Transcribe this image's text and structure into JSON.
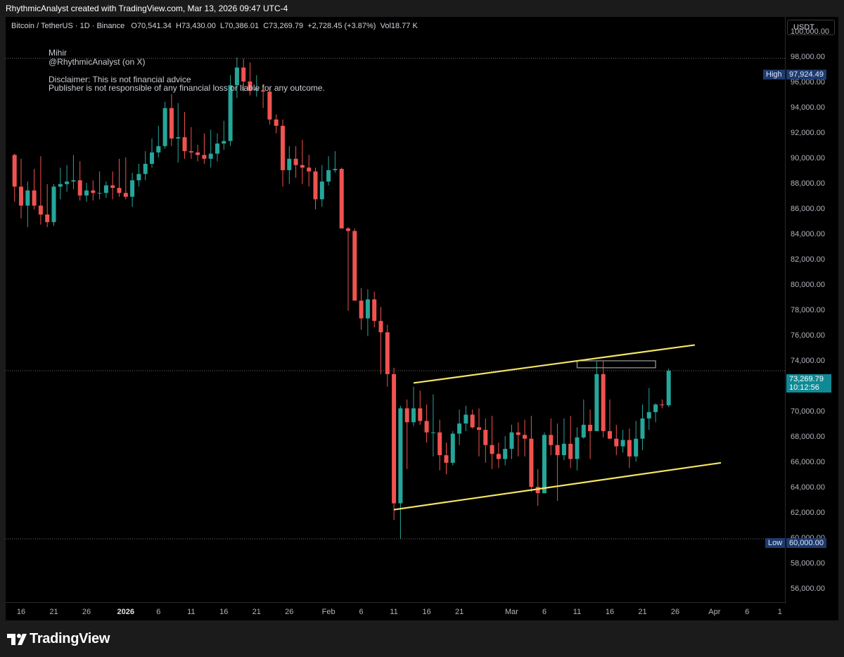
{
  "header": {
    "attribution": "RhythmicAnalyst created with TradingView.com, Mar 13, 2026 09:47 UTC-4"
  },
  "legend": {
    "symbol": "Bitcoin / TetherUS · 1D · Binance",
    "open_label": "O",
    "open": "70,541.34",
    "high_label": "H",
    "high": "73,430.00",
    "low_label": "L",
    "low": "70,386.01",
    "close_label": "C",
    "close": "73,269.79",
    "change": "+2,728.45 (+3.87%)",
    "vol_label": "Vol",
    "vol": "18.77 K"
  },
  "notes": {
    "author": "Mihir",
    "handle": "@RhythmicAnalyst (on X)",
    "disclaimer1": "Disclaimer: This is not financial advice",
    "disclaimer2": "Publisher is not responsible of any financial loss or liable for any outcome."
  },
  "currency": "USDT",
  "markers": {
    "high_label": "High",
    "high_value": "97,924.49",
    "low_label": "Low",
    "low_value": "60,000.00",
    "last_price": "73,269.79",
    "countdown": "10:12:56"
  },
  "footer": {
    "brand": "TradingView"
  },
  "colors": {
    "up": "#26a69a",
    "down": "#ef5350",
    "trendline": "#f5e663",
    "background": "#000000",
    "zone": "#9e9e9e"
  },
  "chart_data": {
    "type": "candlestick",
    "title": "",
    "xlabel": "",
    "ylabel": "",
    "ylim": [
      55000,
      101200
    ],
    "grid": false,
    "y_ticks": [
      56000,
      58000,
      60000,
      62000,
      64000,
      66000,
      68000,
      70000,
      72000,
      74000,
      76000,
      78000,
      80000,
      82000,
      84000,
      86000,
      88000,
      90000,
      92000,
      94000,
      96000,
      98000,
      100000
    ],
    "y_tick_labels": [
      "56,000.00",
      "58,000.00",
      "60,000.00",
      "62,000.00",
      "64,000.00",
      "66,000.00",
      "68,000.00",
      "70,000.00",
      "72,000.00",
      "74,000.00",
      "76,000.00",
      "78,000.00",
      "80,000.00",
      "82,000.00",
      "84,000.00",
      "86,000.00",
      "88,000.00",
      "90,000.00",
      "92,000.00",
      "94,000.00",
      "96,000.00",
      "98,000.00",
      "100,000.00"
    ],
    "x_ticks": [
      {
        "label": "16",
        "day": 0
      },
      {
        "label": "21",
        "day": 5
      },
      {
        "label": "26",
        "day": 10
      },
      {
        "label": "2026",
        "day": 16,
        "bold": true
      },
      {
        "label": "6",
        "day": 21
      },
      {
        "label": "11",
        "day": 26
      },
      {
        "label": "16",
        "day": 31
      },
      {
        "label": "21",
        "day": 36
      },
      {
        "label": "26",
        "day": 41
      },
      {
        "label": "Feb",
        "day": 47
      },
      {
        "label": "6",
        "day": 52
      },
      {
        "label": "11",
        "day": 57
      },
      {
        "label": "16",
        "day": 62
      },
      {
        "label": "21",
        "day": 67
      },
      {
        "label": "Mar",
        "day": 75
      },
      {
        "label": "6",
        "day": 80
      },
      {
        "label": "11",
        "day": 85
      },
      {
        "label": "16",
        "day": 90
      },
      {
        "label": "21",
        "day": 95
      },
      {
        "label": "26",
        "day": 100
      },
      {
        "label": "Apr",
        "day": 106
      },
      {
        "label": "6",
        "day": 111
      },
      {
        "label": "1",
        "day": 116
      }
    ],
    "candles": [
      [
        90300,
        90400,
        86600,
        87800
      ],
      [
        87800,
        90000,
        85300,
        86300
      ],
      [
        86300,
        88200,
        84600,
        87500
      ],
      [
        87500,
        89200,
        86000,
        86300
      ],
      [
        86300,
        90200,
        84800,
        85600
      ],
      [
        85600,
        88000,
        84600,
        85000
      ],
      [
        85000,
        88000,
        84700,
        87800
      ],
      [
        87800,
        89300,
        86800,
        88000
      ],
      [
        88000,
        89500,
        87400,
        88200
      ],
      [
        88200,
        90300,
        87600,
        88300
      ],
      [
        88300,
        89800,
        86700,
        87100
      ],
      [
        87100,
        88100,
        86600,
        87500
      ],
      [
        87500,
        88300,
        86700,
        87300
      ],
      [
        87300,
        89000,
        86800,
        87300
      ],
      [
        87300,
        88200,
        86900,
        87900
      ],
      [
        87900,
        89000,
        86800,
        87700
      ],
      [
        87700,
        90000,
        87000,
        87300
      ],
      [
        87300,
        90100,
        86800,
        87000
      ],
      [
        87000,
        88900,
        86200,
        88300
      ],
      [
        88300,
        89600,
        87800,
        88800
      ],
      [
        88800,
        90600,
        88300,
        89600
      ],
      [
        89600,
        91600,
        89300,
        90500
      ],
      [
        90500,
        92600,
        90100,
        91000
      ],
      [
        91000,
        94500,
        90800,
        94000
      ],
      [
        94000,
        95100,
        91000,
        91600
      ],
      [
        91600,
        94400,
        89700,
        91700
      ],
      [
        91700,
        93700,
        90000,
        90600
      ],
      [
        90600,
        92500,
        90000,
        90500
      ],
      [
        90500,
        91100,
        89800,
        90300
      ],
      [
        90300,
        92000,
        89600,
        90000
      ],
      [
        90000,
        92300,
        89300,
        90400
      ],
      [
        90400,
        92000,
        89800,
        91200
      ],
      [
        91200,
        93000,
        90700,
        91400
      ],
      [
        91400,
        96600,
        91000,
        95800
      ],
      [
        95800,
        98000,
        94800,
        97200
      ],
      [
        97200,
        97900,
        95300,
        96100
      ],
      [
        96100,
        97600,
        95000,
        95400
      ],
      [
        95400,
        96600,
        94900,
        95500
      ],
      [
        95400,
        95900,
        94000,
        95300
      ],
      [
        95300,
        95600,
        92700,
        93100
      ],
      [
        93100,
        93500,
        92000,
        92600
      ],
      [
        92600,
        93100,
        87800,
        89100
      ],
      [
        89100,
        91000,
        88000,
        90000
      ],
      [
        90000,
        91000,
        88500,
        89500
      ],
      [
        89500,
        91500,
        88000,
        89300
      ],
      [
        89300,
        90300,
        87800,
        89000
      ],
      [
        89000,
        89300,
        86000,
        86800
      ],
      [
        86800,
        89500,
        86200,
        88200
      ],
      [
        88200,
        90200,
        87900,
        89100
      ],
      [
        89100,
        90600,
        88900,
        89200
      ],
      [
        89200,
        89300,
        84900,
        84500
      ],
      [
        84500,
        84600,
        78000,
        84300
      ],
      [
        84300,
        84500,
        79000,
        78800
      ],
      [
        78800,
        79800,
        76500,
        77400
      ],
      [
        77400,
        79700,
        76000,
        78900
      ],
      [
        78900,
        79500,
        76700,
        77200
      ],
      [
        77200,
        78300,
        73000,
        76300
      ],
      [
        76300,
        76900,
        72000,
        73000
      ],
      [
        73000,
        73500,
        61500,
        62800
      ],
      [
        62800,
        70500,
        60000,
        70300
      ],
      [
        70300,
        71000,
        65500,
        69200
      ],
      [
        69200,
        72000,
        68900,
        70300
      ],
      [
        70300,
        71700,
        69000,
        69300
      ],
      [
        69300,
        70600,
        67600,
        68400
      ],
      [
        68400,
        71400,
        66500,
        68400
      ],
      [
        68400,
        69400,
        65400,
        66600
      ],
      [
        66600,
        67600,
        65100,
        66000
      ],
      [
        66000,
        68500,
        65800,
        68300
      ],
      [
        68300,
        70200,
        67400,
        69100
      ],
      [
        69100,
        70500,
        68500,
        69800
      ],
      [
        69800,
        70200,
        68700,
        68800
      ],
      [
        68800,
        70300,
        66500,
        68600
      ],
      [
        68600,
        69500,
        66000,
        67400
      ],
      [
        67400,
        69700,
        65500,
        66700
      ],
      [
        66700,
        67600,
        65600,
        66300
      ],
      [
        66300,
        68100,
        65800,
        67100
      ],
      [
        67100,
        69000,
        66300,
        68400
      ],
      [
        68400,
        69200,
        66500,
        68200
      ],
      [
        68200,
        69400,
        66500,
        67900
      ],
      [
        67900,
        69700,
        63700,
        64100
      ],
      [
        64100,
        65500,
        62600,
        63600
      ],
      [
        63600,
        68400,
        63600,
        68200
      ],
      [
        68200,
        69500,
        66600,
        67400
      ],
      [
        67400,
        69100,
        63000,
        66600
      ],
      [
        66600,
        69500,
        66200,
        67500
      ],
      [
        67500,
        69700,
        65600,
        66300
      ],
      [
        66300,
        68800,
        65400,
        68000
      ],
      [
        68000,
        71000,
        67900,
        69000
      ],
      [
        69000,
        70200,
        66300,
        68500
      ],
      [
        68500,
        74000,
        68500,
        73000
      ],
      [
        73000,
        74000,
        68000,
        68500
      ],
      [
        68500,
        71000,
        67900,
        67900
      ],
      [
        67900,
        69000,
        66600,
        67300
      ],
      [
        67300,
        68600,
        66800,
        67800
      ],
      [
        67800,
        68700,
        65600,
        66500
      ],
      [
        66500,
        69300,
        66100,
        67900
      ],
      [
        67900,
        70600,
        67000,
        69500
      ],
      [
        69500,
        71900,
        68600,
        70000
      ],
      [
        70000,
        70700,
        69200,
        70600
      ],
      [
        70600,
        71000,
        70300,
        70540
      ],
      [
        70540,
        73430,
        70386,
        73270
      ]
    ],
    "trendlines": [
      {
        "name": "upper",
        "points": [
          [
            60,
            72300
          ],
          [
            103,
            75300
          ]
        ]
      },
      {
        "name": "lower",
        "points": [
          [
            57,
            62300
          ],
          [
            107,
            66000
          ]
        ]
      }
    ],
    "zone": {
      "day_start": 85,
      "day_end": 97,
      "y_low": 73500,
      "y_high": 74050
    },
    "horizontal_lines": [
      97924.49,
      60000,
      73269.79
    ]
  }
}
